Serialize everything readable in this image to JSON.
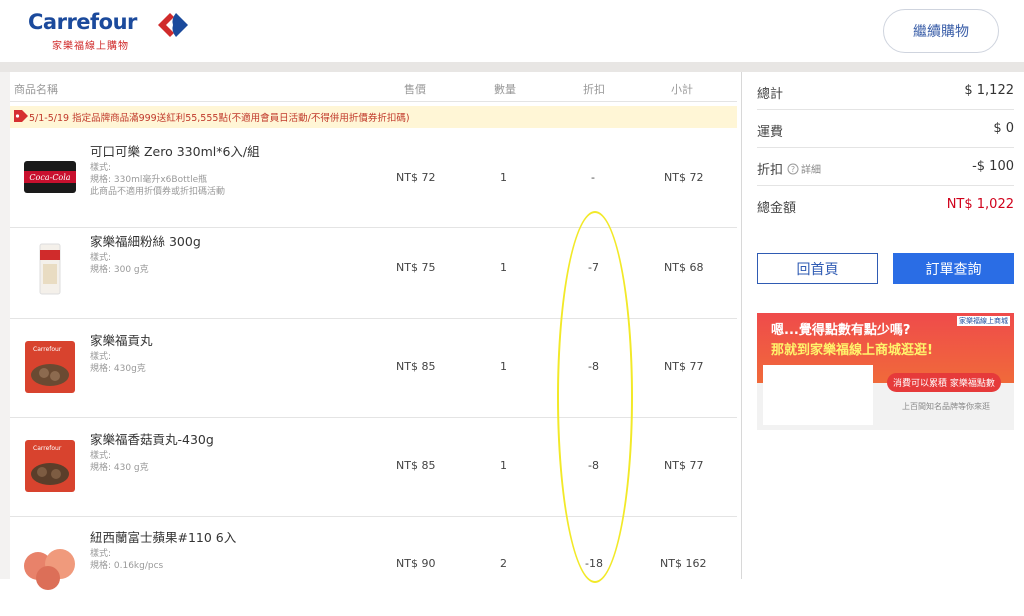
{
  "header": {
    "logo_text": "Carrefour",
    "logo_sub": "家樂福線上購物",
    "continue_label": "繼續購物"
  },
  "table": {
    "headers": {
      "name": "商品名稱",
      "price": "售價",
      "qty": "數量",
      "discount": "折扣",
      "subtotal": "小計"
    },
    "promo": "5/1-5/19 指定品牌商品滿999送紅利55,555點(不適用會員日活動/不得併用折價券折扣碼)",
    "rows": [
      {
        "name": "可口可樂 Zero 330ml*6入/組",
        "spec1": "樣式:",
        "spec2": "規格: 330ml毫升x6Bottle瓶",
        "spec3": "此商品不適用折價券或折扣碼活動",
        "price": "NT$ 72",
        "qty": "1",
        "discount": "-",
        "subtotal": "NT$ 72",
        "thumb": "coke-can-pack-image"
      },
      {
        "name": "家樂福細粉絲 300g",
        "spec1": "樣式:",
        "spec2": "規格: 300 g克",
        "spec3": "",
        "price": "NT$ 75",
        "qty": "1",
        "discount": "-7",
        "subtotal": "NT$ 68",
        "thumb": "vermicelli-pack-image"
      },
      {
        "name": "家樂福貢丸",
        "spec1": "樣式:",
        "spec2": "規格: 430g克",
        "spec3": "",
        "price": "NT$ 85",
        "qty": "1",
        "discount": "-8",
        "subtotal": "NT$ 77",
        "thumb": "meatball-bag-image"
      },
      {
        "name": "家樂福香菇貢丸-430g",
        "spec1": "樣式:",
        "spec2": "規格: 430 g克",
        "spec3": "",
        "price": "NT$ 85",
        "qty": "1",
        "discount": "-8",
        "subtotal": "NT$ 77",
        "thumb": "mushroom-meatball-bag-image"
      },
      {
        "name": "紐西蘭富士蘋果#110 6入",
        "spec1": "樣式:",
        "spec2": "規格: 0.16kg/pcs",
        "spec3": "",
        "price": "NT$ 90",
        "qty": "2",
        "discount": "-18",
        "subtotal": "NT$ 162",
        "thumb": "apples-image"
      }
    ]
  },
  "summary": {
    "total_label": "總計",
    "total_value": "$ 1,122",
    "shipping_label": "運費",
    "shipping_value": "$ 0",
    "discount_label": "折扣",
    "discount_detail": "詳細",
    "discount_value": "-$ 100",
    "grand_label": "總金額",
    "grand_value": "NT$ 1,022",
    "grand_color": "#d0021b"
  },
  "actions": {
    "home_label": "回首頁",
    "orders_label": "訂單查詢"
  },
  "banner": {
    "brand": "家樂福線上商城",
    "headline1": "嗯...覺得點數有點少嗎?",
    "headline2": "那就到家樂福線上商城逛逛!",
    "pill": "消費可以累積 家樂福點數",
    "footer": "上百間知名品牌等你來逛"
  }
}
